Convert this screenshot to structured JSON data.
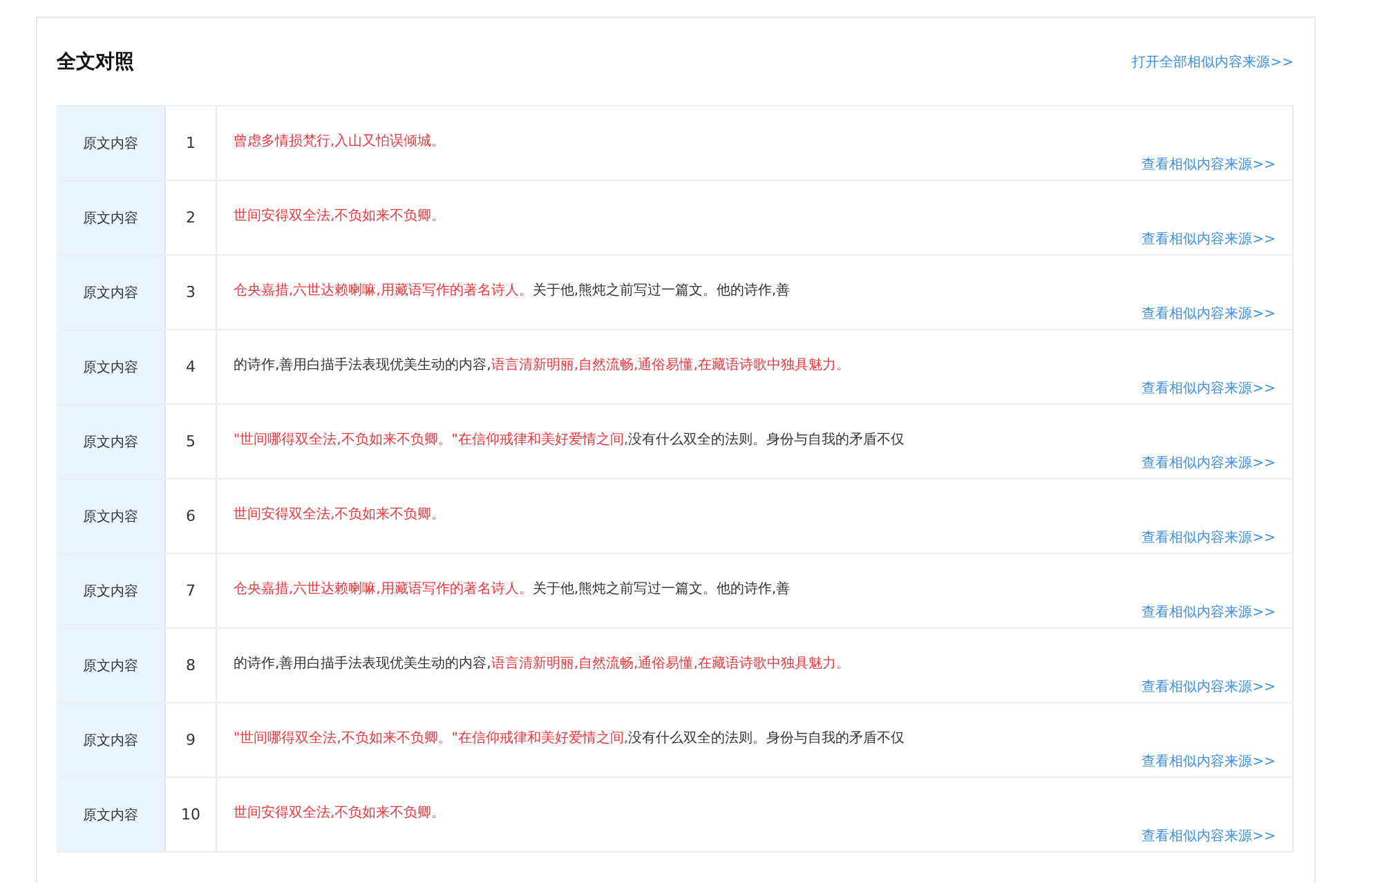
{
  "title": "全文对照",
  "open_all_link": "打开全部相似内容来源>>",
  "rows": [
    {
      "label": "原文内容",
      "number": "1",
      "segments": [
        {
          "text": "曾虑多情损梵行,入山又怕误倾城。",
          "flagged": true
        }
      ],
      "link": "查看相似内容来源>>"
    },
    {
      "label": "原文内容",
      "number": "2",
      "segments": [
        {
          "text": "世间安得双全法,不负如来不负卿。",
          "flagged": true
        }
      ],
      "link": "查看相似内容来源>>"
    },
    {
      "label": "原文内容",
      "number": "3",
      "segments": [
        {
          "text": "仓央嘉措,六世达赖喇嘛,用藏语写作的著名诗人。",
          "flagged": true
        },
        {
          "text": "关于他,熊炖之前写过一篇文。他的诗作,善",
          "flagged": false
        }
      ],
      "link": "查看相似内容来源>>"
    },
    {
      "label": "原文内容",
      "number": "4",
      "segments": [
        {
          "text": "的诗作,善用白描手法表现优美生动的内容,",
          "flagged": false
        },
        {
          "text": "语言清新明丽,自然流畅,通俗易懂,在藏语诗歌中独具魅力。",
          "flagged": true
        }
      ],
      "link": "查看相似内容来源>>"
    },
    {
      "label": "原文内容",
      "number": "5",
      "segments": [
        {
          "text": "\"世间哪得双全法,不负如来不负卿。\"在信仰戒律和美好爱情之间,",
          "flagged": true
        },
        {
          "text": "没有什么双全的法则。身份与自我的矛盾不仅",
          "flagged": false
        }
      ],
      "link": "查看相似内容来源>>"
    },
    {
      "label": "原文内容",
      "number": "6",
      "segments": [
        {
          "text": "世间安得双全法,不负如来不负卿。",
          "flagged": true
        }
      ],
      "link": "查看相似内容来源>>"
    },
    {
      "label": "原文内容",
      "number": "7",
      "segments": [
        {
          "text": "仓央嘉措,六世达赖喇嘛,用藏语写作的著名诗人。",
          "flagged": true
        },
        {
          "text": "关于他,熊炖之前写过一篇文。他的诗作,善",
          "flagged": false
        }
      ],
      "link": "查看相似内容来源>>"
    },
    {
      "label": "原文内容",
      "number": "8",
      "segments": [
        {
          "text": "的诗作,善用白描手法表现优美生动的内容,",
          "flagged": false
        },
        {
          "text": "语言清新明丽,自然流畅,通俗易懂,在藏语诗歌中独具魅力。",
          "flagged": true
        }
      ],
      "link": "查看相似内容来源>>"
    },
    {
      "label": "原文内容",
      "number": "9",
      "segments": [
        {
          "text": "\"世间哪得双全法,不负如来不负卿。\"在信仰戒律和美好爱情之间,",
          "flagged": true
        },
        {
          "text": "没有什么双全的法则。身份与自我的矛盾不仅",
          "flagged": false
        }
      ],
      "link": "查看相似内容来源>>"
    },
    {
      "label": "原文内容",
      "number": "10",
      "segments": [
        {
          "text": "世间安得双全法,不负如来不负卿。",
          "flagged": true
        }
      ],
      "link": "查看相似内容来源>>"
    }
  ]
}
